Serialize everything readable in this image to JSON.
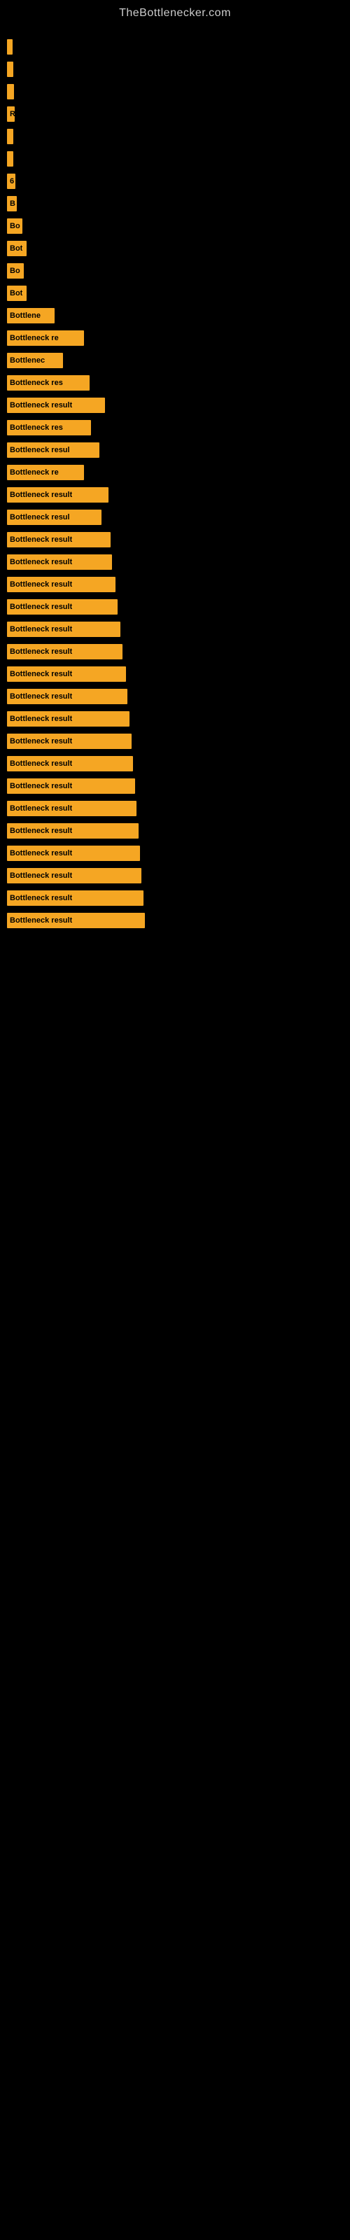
{
  "site": {
    "title": "TheBottlenecker.com"
  },
  "bars": [
    {
      "id": 1,
      "label": "",
      "width": 8
    },
    {
      "id": 2,
      "label": "",
      "width": 9
    },
    {
      "id": 3,
      "label": "",
      "width": 10
    },
    {
      "id": 4,
      "label": "R",
      "width": 11
    },
    {
      "id": 5,
      "label": "",
      "width": 9
    },
    {
      "id": 6,
      "label": "",
      "width": 9
    },
    {
      "id": 7,
      "label": "6",
      "width": 12
    },
    {
      "id": 8,
      "label": "B",
      "width": 14
    },
    {
      "id": 9,
      "label": "Bo",
      "width": 22
    },
    {
      "id": 10,
      "label": "Bot",
      "width": 28
    },
    {
      "id": 11,
      "label": "Bo",
      "width": 24
    },
    {
      "id": 12,
      "label": "Bot",
      "width": 28
    },
    {
      "id": 13,
      "label": "Bottlene",
      "width": 68
    },
    {
      "id": 14,
      "label": "Bottleneck re",
      "width": 110
    },
    {
      "id": 15,
      "label": "Bottlenec",
      "width": 80
    },
    {
      "id": 16,
      "label": "Bottleneck res",
      "width": 118
    },
    {
      "id": 17,
      "label": "Bottleneck result",
      "width": 140
    },
    {
      "id": 18,
      "label": "Bottleneck res",
      "width": 120
    },
    {
      "id": 19,
      "label": "Bottleneck resul",
      "width": 132
    },
    {
      "id": 20,
      "label": "Bottleneck re",
      "width": 110
    },
    {
      "id": 21,
      "label": "Bottleneck result",
      "width": 145
    },
    {
      "id": 22,
      "label": "Bottleneck resul",
      "width": 135
    },
    {
      "id": 23,
      "label": "Bottleneck result",
      "width": 148
    },
    {
      "id": 24,
      "label": "Bottleneck result",
      "width": 150
    },
    {
      "id": 25,
      "label": "Bottleneck result",
      "width": 155
    },
    {
      "id": 26,
      "label": "Bottleneck result",
      "width": 158
    },
    {
      "id": 27,
      "label": "Bottleneck result",
      "width": 162
    },
    {
      "id": 28,
      "label": "Bottleneck result",
      "width": 165
    },
    {
      "id": 29,
      "label": "Bottleneck result",
      "width": 170
    },
    {
      "id": 30,
      "label": "Bottleneck result",
      "width": 172
    },
    {
      "id": 31,
      "label": "Bottleneck result",
      "width": 175
    },
    {
      "id": 32,
      "label": "Bottleneck result",
      "width": 178
    },
    {
      "id": 33,
      "label": "Bottleneck result",
      "width": 180
    },
    {
      "id": 34,
      "label": "Bottleneck result",
      "width": 183
    },
    {
      "id": 35,
      "label": "Bottleneck result",
      "width": 185
    },
    {
      "id": 36,
      "label": "Bottleneck result",
      "width": 188
    },
    {
      "id": 37,
      "label": "Bottleneck result",
      "width": 190
    },
    {
      "id": 38,
      "label": "Bottleneck result",
      "width": 192
    },
    {
      "id": 39,
      "label": "Bottleneck result",
      "width": 195
    },
    {
      "id": 40,
      "label": "Bottleneck result",
      "width": 197
    }
  ]
}
